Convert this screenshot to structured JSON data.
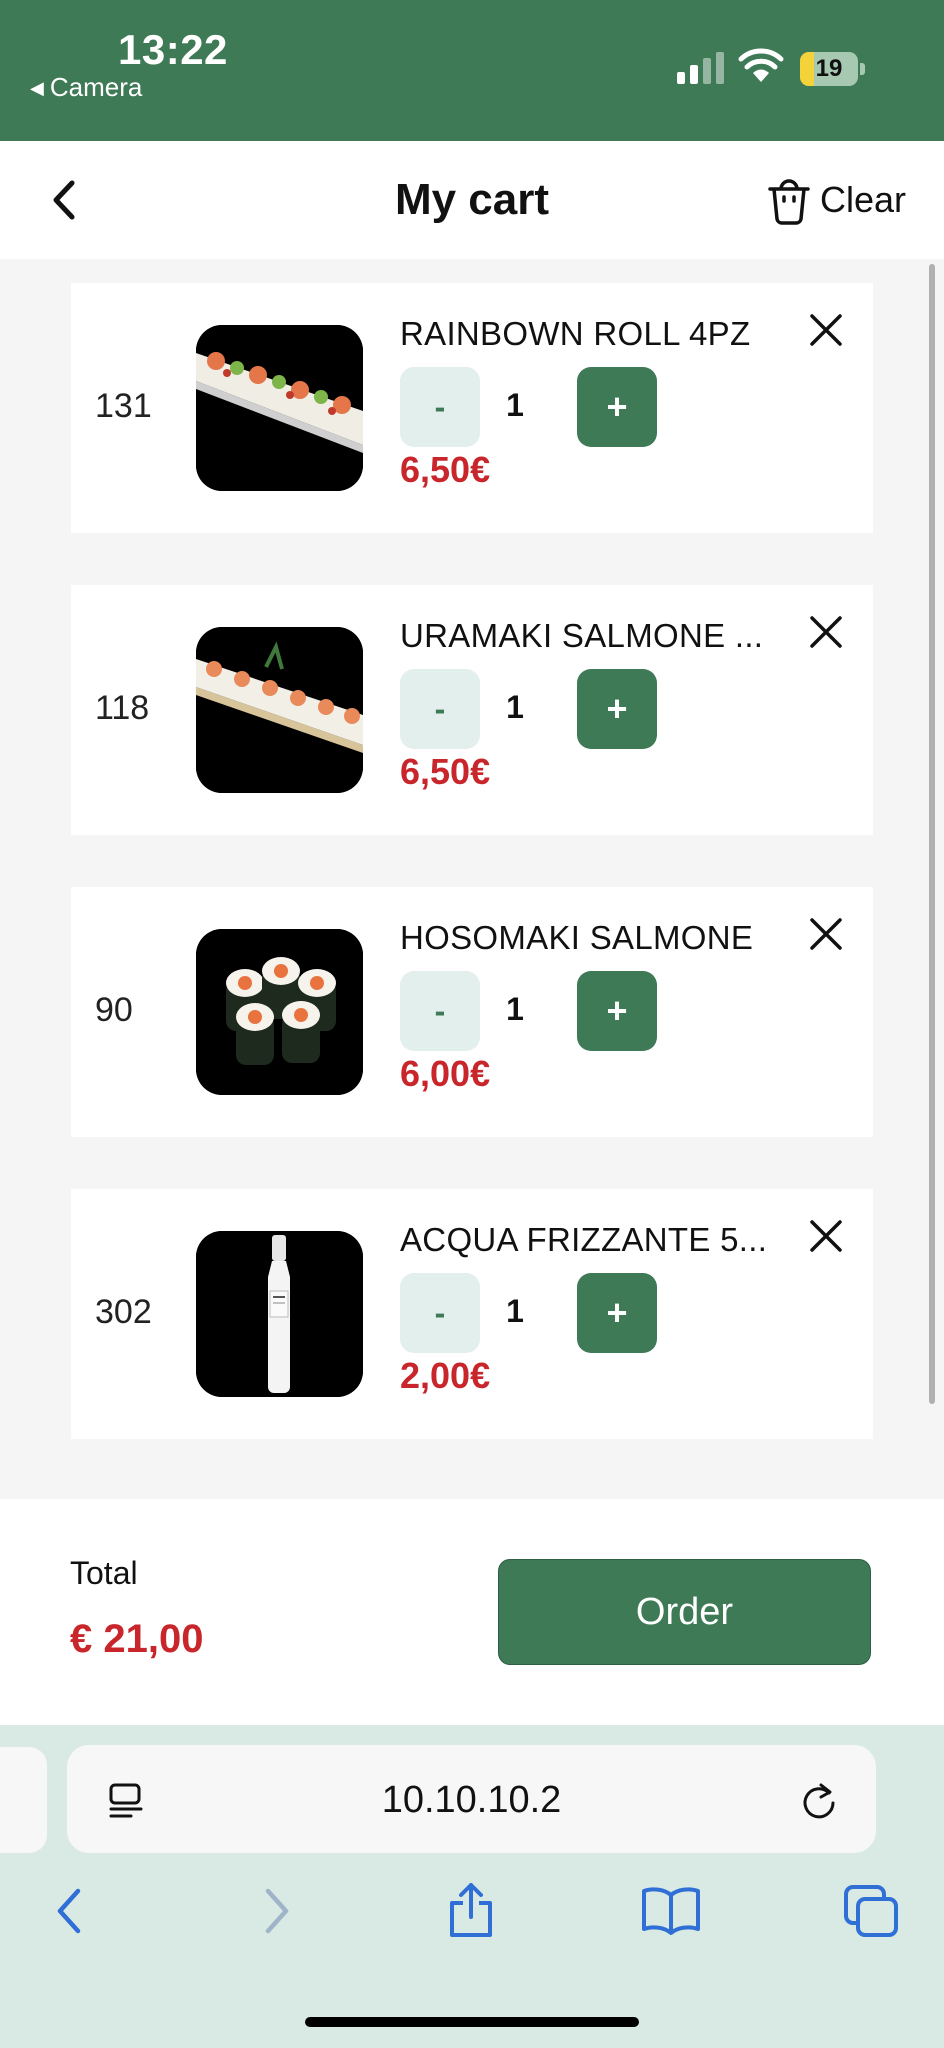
{
  "status_bar": {
    "time": "13:22",
    "back_app": "Camera",
    "battery": "19"
  },
  "header": {
    "title": "My cart",
    "clear_label": "Clear"
  },
  "cart": {
    "items": [
      {
        "code": "131",
        "name": "RAINBOWN ROLL 4PZ",
        "qty": "1",
        "price": "6,50€",
        "minus": "-",
        "plus": "+"
      },
      {
        "code": "118",
        "name": "URAMAKI SALMONE ...",
        "qty": "1",
        "price": "6,50€",
        "minus": "-",
        "plus": "+"
      },
      {
        "code": "90",
        "name": "HOSOMAKI SALMONE",
        "qty": "1",
        "price": "6,00€",
        "minus": "-",
        "plus": "+"
      },
      {
        "code": "302",
        "name": "ACQUA FRIZZANTE 5...",
        "qty": "1",
        "price": "2,00€",
        "minus": "-",
        "plus": "+"
      }
    ]
  },
  "footer": {
    "total_label": "Total",
    "total_value": "€ 21,00",
    "order_label": "Order"
  },
  "browser": {
    "url": "10.10.10.2"
  },
  "colors": {
    "brand_green": "#3f7a56",
    "price_red": "#c8262b",
    "minus_bg": "#e3efec",
    "browser_bg": "#d9e9e3",
    "ios_blue": "#2f6fd6"
  },
  "icons": [
    "back-chevron-icon",
    "trash-icon",
    "close-icon",
    "reader-icon",
    "reload-icon",
    "chevron-left-icon",
    "chevron-right-icon",
    "share-icon",
    "book-icon",
    "tabs-icon"
  ]
}
